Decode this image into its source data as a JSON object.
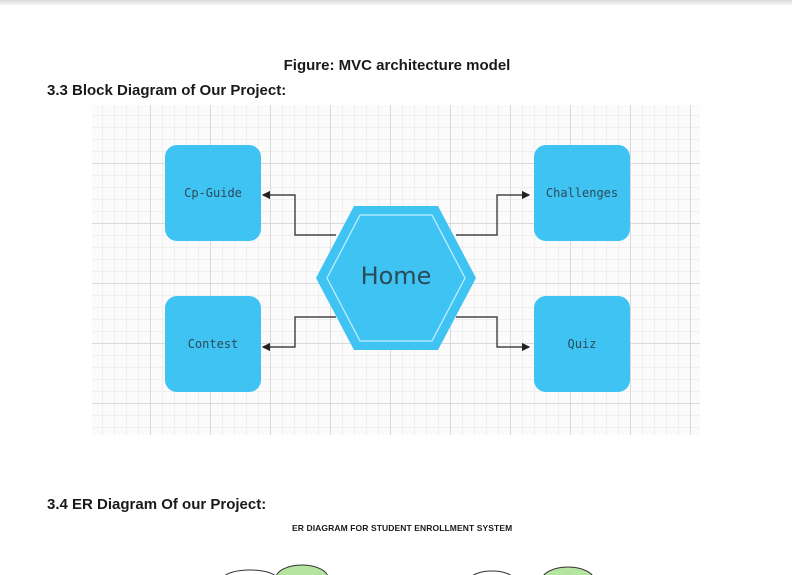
{
  "figure_caption": "Figure: MVC architecture model",
  "section_33": {
    "title": "3.3 Block Diagram of Our Project:"
  },
  "block_diagram": {
    "center": "Home",
    "blocks": {
      "cp_guide": "Cp-Guide",
      "challenges": "Challenges",
      "contest": "Contest",
      "quiz": "Quiz"
    },
    "colors": {
      "block_fill": "#3fc3f2",
      "hex_stroke": "#bfeeff",
      "line": "#222222"
    }
  },
  "section_34": {
    "title": "3.4 ER Diagram Of our Project:",
    "er_caption": "ER DIAGRAM FOR STUDENT ENROLLMENT SYSTEM"
  }
}
